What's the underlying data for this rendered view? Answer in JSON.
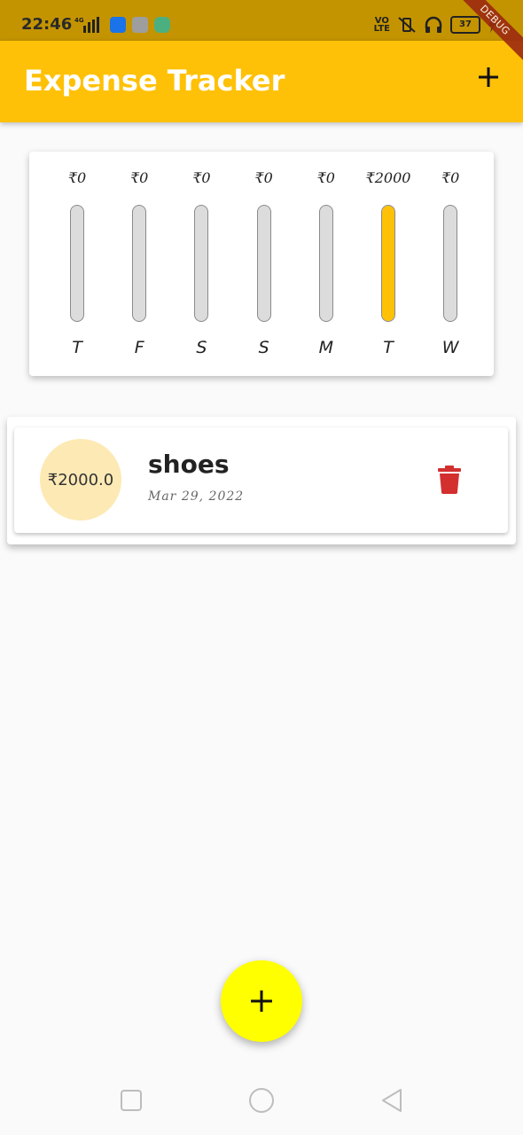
{
  "status_bar": {
    "time": "22:46",
    "network": "4G",
    "volte": "VO LTE",
    "battery": "37",
    "icons": [
      "signal-icon",
      "usb-icon",
      "drive-icon",
      "app-icon",
      "vibrate-icon",
      "headphones-icon",
      "battery-icon",
      "charging-icon"
    ]
  },
  "debug_banner": "DEBUG",
  "app_bar": {
    "title": "Expense Tracker",
    "add_icon": "plus-icon"
  },
  "chart_data": {
    "type": "bar",
    "categories": [
      "T",
      "F",
      "S",
      "S",
      "M",
      "T",
      "W"
    ],
    "amount_labels": [
      "₹0",
      "₹0",
      "₹0",
      "₹0",
      "₹0",
      "₹2000",
      "₹0"
    ],
    "values": [
      0,
      0,
      0,
      0,
      0,
      2000,
      0
    ],
    "fill_fraction": [
      0,
      0,
      0,
      0,
      0,
      1,
      0
    ],
    "fill_color": "#ffc107",
    "track_color": "#dcdcdc"
  },
  "transactions": [
    {
      "amount": "₹2000.0",
      "title": "shoes",
      "date": "Mar 29, 2022",
      "delete_icon": "trash-icon"
    }
  ],
  "fab_icon": "plus-icon",
  "colors": {
    "primary": "#ffc107",
    "status_bar": "#c49400",
    "fab": "#ffff00",
    "delete": "#d32f2f",
    "amount_circle": "#fde9b4"
  },
  "nav_bar": [
    "recent-apps-icon",
    "home-icon",
    "back-icon"
  ]
}
